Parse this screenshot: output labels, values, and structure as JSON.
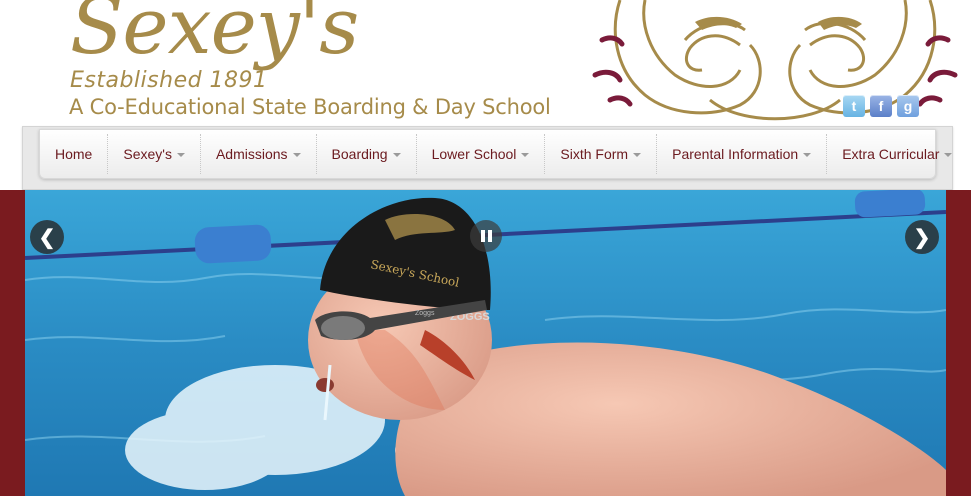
{
  "header": {
    "logo_title": "Sexey's",
    "established": "Established 1891",
    "subtitle": "A Co-Educational State Boarding & Day School"
  },
  "social": [
    {
      "name": "twitter-icon",
      "glyph": "t"
    },
    {
      "name": "facebook-icon",
      "glyph": "f"
    },
    {
      "name": "google-icon",
      "glyph": "g"
    }
  ],
  "nav": {
    "items": [
      {
        "label": "Home",
        "dropdown": false
      },
      {
        "label": "Sexey's",
        "dropdown": true
      },
      {
        "label": "Admissions",
        "dropdown": true
      },
      {
        "label": "Boarding",
        "dropdown": true
      },
      {
        "label": "Lower School",
        "dropdown": true
      },
      {
        "label": "Sixth Form",
        "dropdown": true
      },
      {
        "label": "Parental Information",
        "dropdown": true
      },
      {
        "label": "Extra Curricular",
        "dropdown": true
      }
    ]
  },
  "slideshow": {
    "prev_glyph": "❮",
    "next_glyph": "❯",
    "cap_text": "Sexey's School",
    "cap_brand": "ZOGGS",
    "goggle_brand": "Zoggs"
  },
  "colors": {
    "gold": "#a68b4a",
    "maroon": "#7a1b1f",
    "nav_text": "#6b1a1f"
  }
}
